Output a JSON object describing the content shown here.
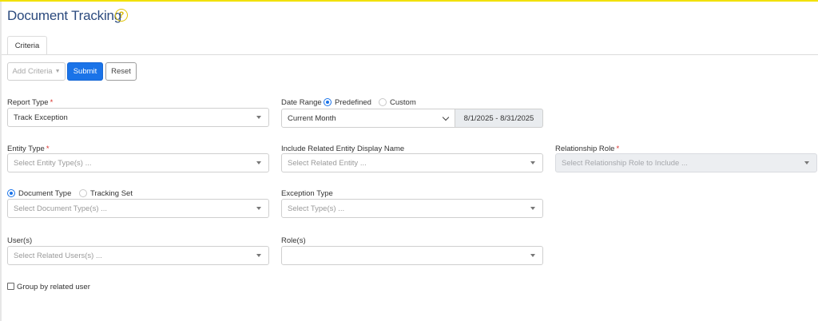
{
  "page": {
    "title": "Document Tracking",
    "help_icon": "help-circle-icon",
    "accent_color": "#f2e100",
    "primary_color": "#1a73e8"
  },
  "tabs": [
    {
      "label": "Criteria",
      "active": true
    }
  ],
  "toolbar": {
    "add_criteria_label": "Add Criteria",
    "submit_label": "Submit",
    "reset_label": "Reset"
  },
  "form": {
    "report_type": {
      "label": "Report Type",
      "required_mark": "*",
      "value": "Track Exception"
    },
    "date_range": {
      "label": "Date Range",
      "options": [
        "Predefined",
        "Custom"
      ],
      "selected": "Predefined",
      "preset_value": "Current Month",
      "range_text": "8/1/2025 - 8/31/2025"
    },
    "entity_type": {
      "label": "Entity Type",
      "required_mark": "*",
      "placeholder": "Select Entity Type(s) ..."
    },
    "related_entity": {
      "label": "Include Related Entity Display Name",
      "placeholder": "Select Related Entity ..."
    },
    "relationship_role": {
      "label": "Relationship Role",
      "required_mark": "*",
      "placeholder": "Select Relationship Role to Include ...",
      "disabled": true
    },
    "doc_mode": {
      "options": [
        "Document Type",
        "Tracking Set"
      ],
      "selected": "Document Type",
      "placeholder": "Select Document Type(s) ..."
    },
    "exception_type": {
      "label": "Exception Type",
      "placeholder": "Select Type(s) ..."
    },
    "users": {
      "label": "User(s)",
      "placeholder": "Select Related Users(s) ..."
    },
    "roles": {
      "label": "Role(s)",
      "value": ""
    },
    "group_by_user": {
      "label": "Group by related user",
      "checked": false
    }
  }
}
